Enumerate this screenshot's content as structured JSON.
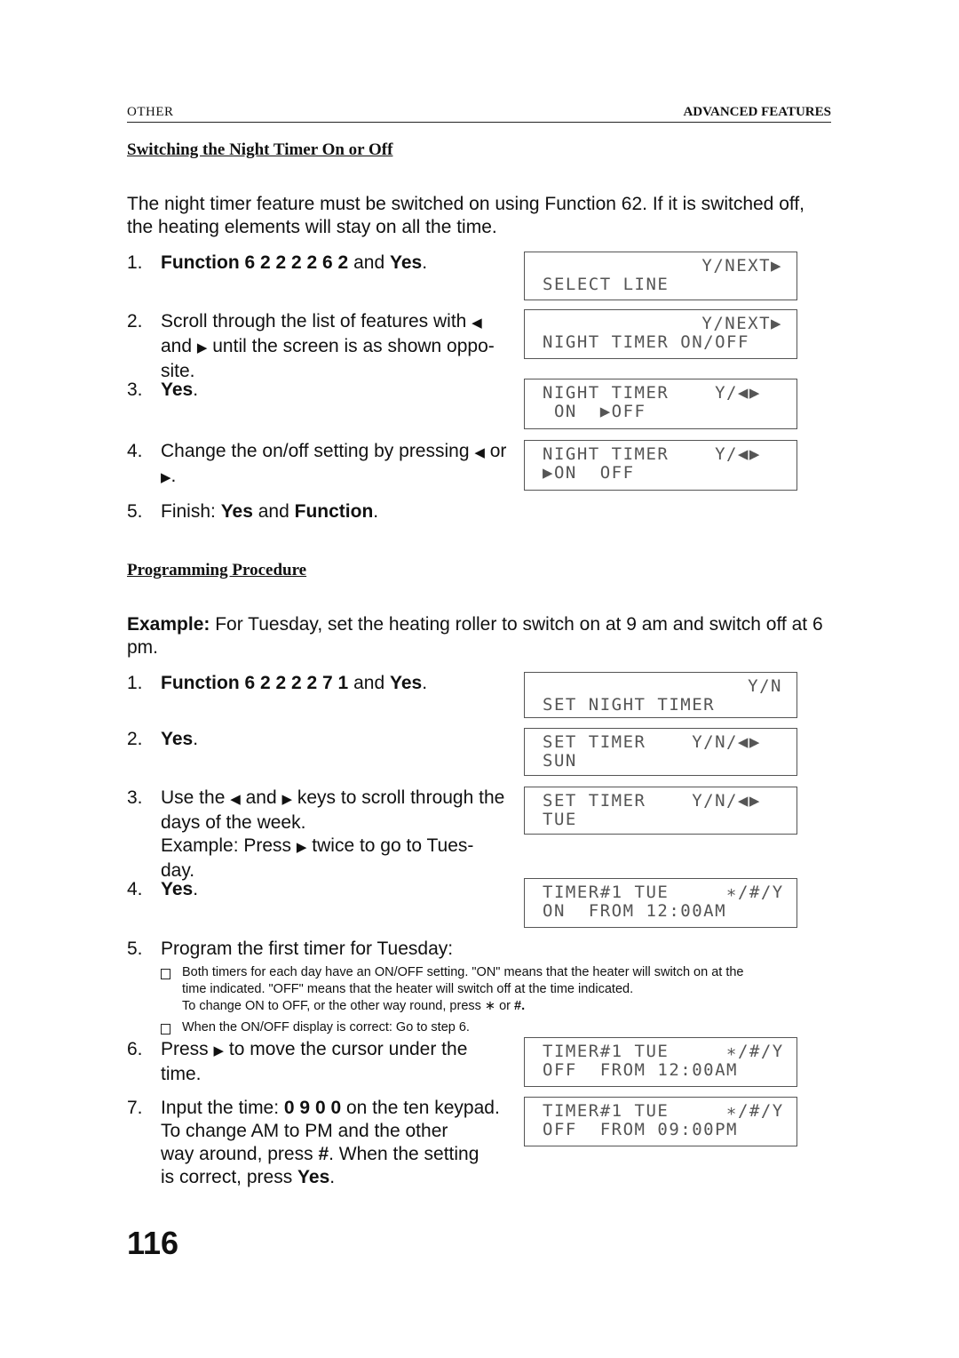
{
  "header": {
    "left": "OTHER",
    "right": "ADVANCED FEATURES"
  },
  "section1": {
    "title": "Switching the Night Timer On or Off",
    "intro": "The night timer feature must be switched on using Function 62. If it is switched off, the heating elements will stay on all the time.",
    "steps": [
      {
        "num": "1.",
        "lines": [
          [
            {
              "t": "Function 6 2 2 2 2 6 2",
              "b": true
            },
            {
              "t": " and "
            },
            {
              "t": "Yes",
              "b": true
            },
            {
              "t": "."
            }
          ]
        ]
      },
      {
        "num": "2.",
        "lines": [
          [
            {
              "t": "Scroll through the list of features with "
            },
            {
              "t": "◀",
              "a": true
            }
          ],
          [
            {
              "t": "and "
            },
            {
              "t": "▶",
              "a": true
            },
            {
              "t": " until the screen is as shown oppo-"
            }
          ],
          [
            {
              "t": "site."
            }
          ]
        ]
      },
      {
        "num": "3.",
        "lines": [
          [
            {
              "t": "Yes",
              "b": true
            },
            {
              "t": "."
            }
          ]
        ]
      },
      {
        "num": "4.",
        "lines": [
          [
            {
              "t": "Change the on/off setting by pressing "
            },
            {
              "t": "◀",
              "a": true
            },
            {
              "t": " or"
            }
          ],
          [
            {
              "t": "▶",
              "a": true
            },
            {
              "t": "."
            }
          ]
        ]
      },
      {
        "num": "5.",
        "lines": [
          [
            {
              "t": "Finish: "
            },
            {
              "t": "Yes",
              "b": true
            },
            {
              "t": " and "
            },
            {
              "t": "Function",
              "b": true
            },
            {
              "t": "."
            }
          ]
        ]
      }
    ]
  },
  "section2": {
    "title": "Programming Procedure",
    "intro_label": "Example:",
    "intro": " For Tuesday, set the heating roller to switch on at 9 am and switch off at 6 pm.",
    "steps": [
      {
        "num": "1.",
        "lines": [
          [
            {
              "t": "Function 6 2 2 2 2 7 1",
              "b": true
            },
            {
              "t": " and "
            },
            {
              "t": "Yes",
              "b": true
            },
            {
              "t": "."
            }
          ]
        ]
      },
      {
        "num": "2.",
        "lines": [
          [
            {
              "t": "Yes",
              "b": true
            },
            {
              "t": "."
            }
          ]
        ]
      },
      {
        "num": "3.",
        "lines": [
          [
            {
              "t": "Use the "
            },
            {
              "t": "◀",
              "a": true
            },
            {
              "t": " and "
            },
            {
              "t": "▶",
              "a": true
            },
            {
              "t": " keys to scroll through the"
            }
          ],
          [
            {
              "t": "days of the week."
            }
          ],
          [
            {
              "t": "Example: Press "
            },
            {
              "t": "▶",
              "a": true
            },
            {
              "t": " twice to go to Tues-"
            }
          ],
          [
            {
              "t": "day."
            }
          ]
        ]
      },
      {
        "num": "4.",
        "lines": [
          [
            {
              "t": "Yes",
              "b": true
            },
            {
              "t": "."
            }
          ]
        ]
      },
      {
        "num": "5.",
        "lines": [
          [
            {
              "t": "Program the first timer for Tuesday:"
            }
          ]
        ]
      },
      {
        "num": "6.",
        "lines": [
          [
            {
              "t": "Press "
            },
            {
              "t": "▶",
              "a": true
            },
            {
              "t": " to move the cursor under the"
            }
          ],
          [
            {
              "t": "time."
            }
          ]
        ]
      },
      {
        "num": "7.",
        "lines": [
          [
            {
              "t": "Input the time: "
            },
            {
              "t": "0 9 0 0",
              "b": true
            },
            {
              "t": " on the ten keypad."
            }
          ],
          [
            {
              "t": "To change AM to PM and the other"
            }
          ],
          [
            {
              "t": "way around, press "
            },
            {
              "t": "#",
              "b": true
            },
            {
              "t": ". When the setting"
            }
          ],
          [
            {
              "t": "is correct, press "
            },
            {
              "t": "Yes",
              "b": true
            },
            {
              "t": "."
            }
          ]
        ]
      }
    ],
    "notes": [
      {
        "box": true,
        "lines": [
          [
            {
              "t": "Both timers for each day have an ON/OFF setting. \"ON\" means that the heater will switch on at the"
            }
          ],
          [
            {
              "t": "time indicated. \"OFF\" means that the heater will switch off at the time indicated."
            }
          ],
          [
            {
              "t": "To change ON to OFF, or the other way round, press ∗ or "
            },
            {
              "t": "#.",
              "b": true
            }
          ]
        ]
      },
      {
        "box": true,
        "lines": [
          [
            {
              "t": "When the ON/OFF display is correct: Go to step 6."
            }
          ]
        ]
      }
    ]
  },
  "displays": [
    {
      "line1": "Y/NEXT▶",
      "line1_right": true,
      "line2": "SELECT LINE"
    },
    {
      "line1": "Y/NEXT▶",
      "line1_right": true,
      "line2": "NIGHT TIMER ON/OFF"
    },
    {
      "line1": "NIGHT TIMER    Y/◀▶",
      "line2": " ON  ▶OFF"
    },
    {
      "line1": "NIGHT TIMER    Y/◀▶",
      "line2": "▶ON  OFF"
    },
    {
      "line1": "Y/N",
      "line1_right": true,
      "line2": "SET NIGHT TIMER"
    },
    {
      "line1": "SET TIMER    Y/N/◀▶",
      "line2": "SUN"
    },
    {
      "line1": "SET TIMER    Y/N/◀▶",
      "line2": "TUE"
    },
    {
      "line1": "TIMER#1 TUE     ∗/#/Y",
      "line2": "ON  FROM 12:00AM"
    },
    {
      "line1": "TIMER#1 TUE     ∗/#/Y",
      "line2": "OFF  FROM 12:00AM"
    },
    {
      "line1": "TIMER#1 TUE     ∗/#/Y",
      "line2": "OFF  FROM 09:00PM"
    }
  ],
  "page_number": "116"
}
